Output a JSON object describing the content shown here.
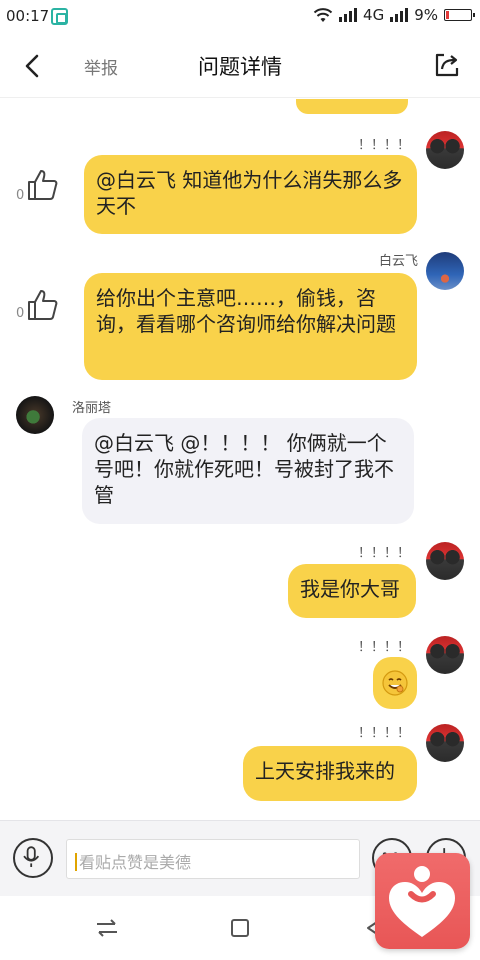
{
  "status_bar": {
    "time": "00:17",
    "network": "4G",
    "battery": "9%",
    "battery_level": 0.09
  },
  "header": {
    "report_label": "举报",
    "title": "问题详情"
  },
  "messages": [
    {
      "sender": "！！！！",
      "side": "right",
      "text": "@白云飞 知道他为什么消失那么多天不",
      "likes": "0"
    },
    {
      "sender": "白云飞",
      "side": "right",
      "text": "给你出个主意吧……，偷钱，咨询，看看哪个咨询师给你解决问题",
      "likes": "0"
    },
    {
      "sender": "洛丽塔",
      "side": "left",
      "text": "@白云飞 @！！！！ 你俩就一个号吧！你就作死吧！号被封了我不管"
    },
    {
      "sender": "！！！！",
      "side": "right",
      "text": "我是你大哥"
    },
    {
      "sender": "！！！！",
      "side": "right",
      "text": "",
      "emoji": "grinning-face"
    },
    {
      "sender": "！！！！",
      "side": "right",
      "text": "上天安排我来的"
    }
  ],
  "input": {
    "placeholder": "看贴点赞是美德"
  },
  "colors": {
    "bubble_self": "#f9d24a",
    "bubble_other": "#f2f2f7",
    "float_app": "#e85656"
  },
  "icons": [
    "back-arrow-icon",
    "share-icon",
    "thumbs-up-icon",
    "microphone-icon",
    "emoji-icon",
    "plus-icon",
    "switch-icon",
    "square-icon",
    "back-triangle-icon",
    "heart-app-icon"
  ]
}
